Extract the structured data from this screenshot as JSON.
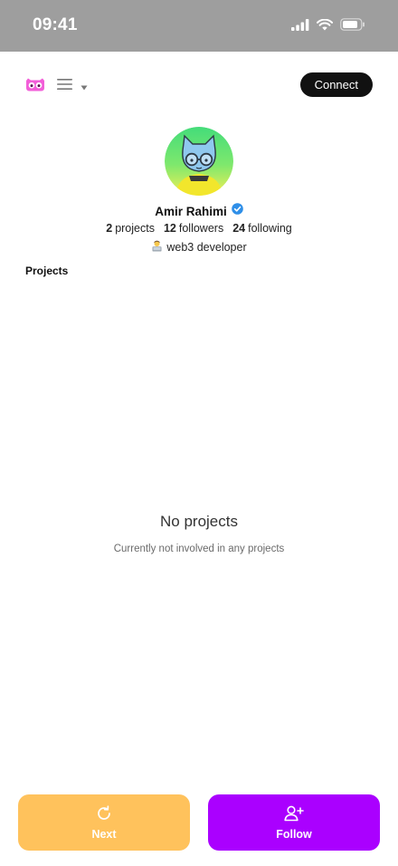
{
  "status_bar": {
    "time": "09:41"
  },
  "header": {
    "connect_label": "Connect"
  },
  "profile": {
    "name": "Amir Rahimi",
    "projects_count": "2",
    "projects_label": "projects",
    "followers_count": "12",
    "followers_label": "followers",
    "following_count": "24",
    "following_label": "following",
    "bio": "web3 developer"
  },
  "projects_section": {
    "title": "Projects",
    "empty_title": "No projects",
    "empty_subtitle": "Currently not involved in any projects"
  },
  "actions": {
    "next_label": "Next",
    "follow_label": "Follow"
  },
  "colors": {
    "status_bar": "#9e9e9e",
    "next_button": "#ffc25c",
    "follow_button": "#aa00ff",
    "brand_pink": "#f25ed8",
    "verified_blue": "#2f8fe8"
  }
}
